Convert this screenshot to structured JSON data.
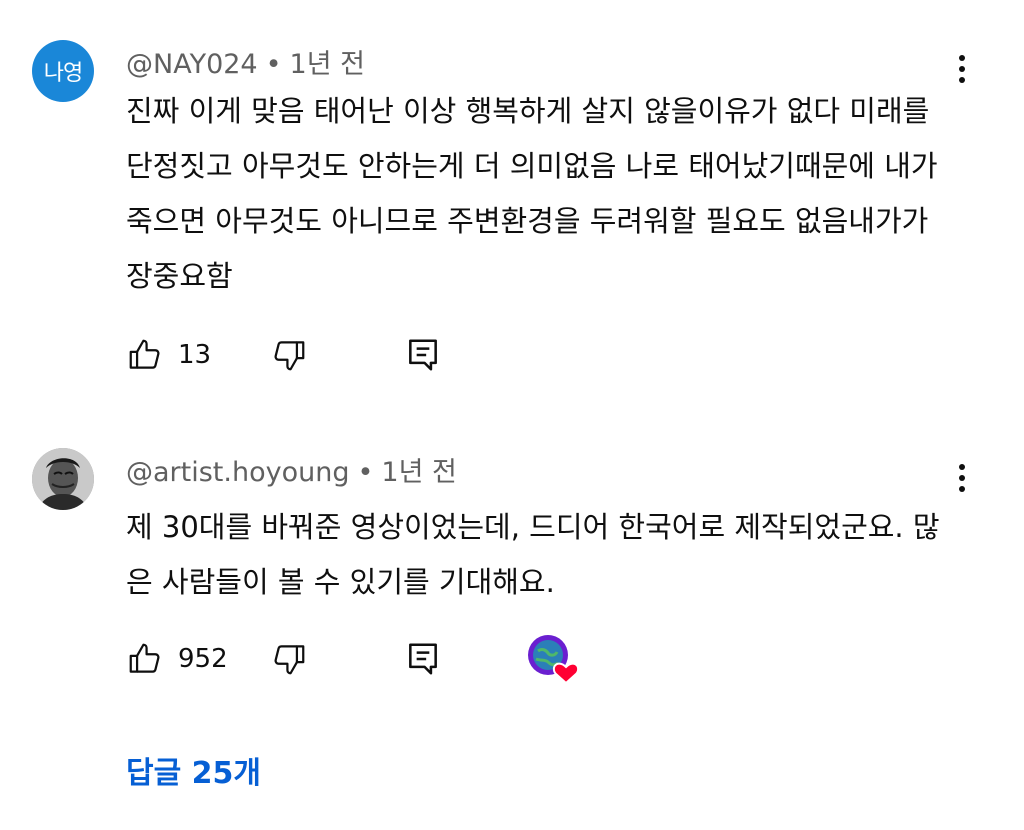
{
  "comments": [
    {
      "avatar_text": "나영",
      "username": "@NAY024",
      "separator": "•",
      "time": "1년 전",
      "text": "진짜 이게 맞음 태어난 이상 행복하게 살지 않을이유가 없다 미래를 단정짓고 아무것도 안하는게 더 의미없음 나로 태어났기때문에 내가 죽으면 아무것도 아니므로 주변환경을 두려워할 필요도 없음내가가장중요함",
      "likes": "13",
      "avatar_color": "#1a87d8"
    },
    {
      "username": "@artist.hoyoung",
      "separator": "•",
      "time": "1년 전",
      "text": "제 30대를 바꿔준 영상이었는데, 드디어 한국어로 제작되었군요. 많은 사람들이 볼 수 있기를 기대해요.",
      "likes": "952",
      "creator_heart": true
    }
  ],
  "replies_label": "답글 25개",
  "icons": {
    "like": "thumb-up-icon",
    "dislike": "thumb-down-icon",
    "reply": "comment-reply-icon",
    "more": "more-vert-icon",
    "heart": "creator-heart-icon"
  },
  "colors": {
    "link": "#065fd4",
    "meta": "#606060",
    "heart": "#ff0033"
  }
}
